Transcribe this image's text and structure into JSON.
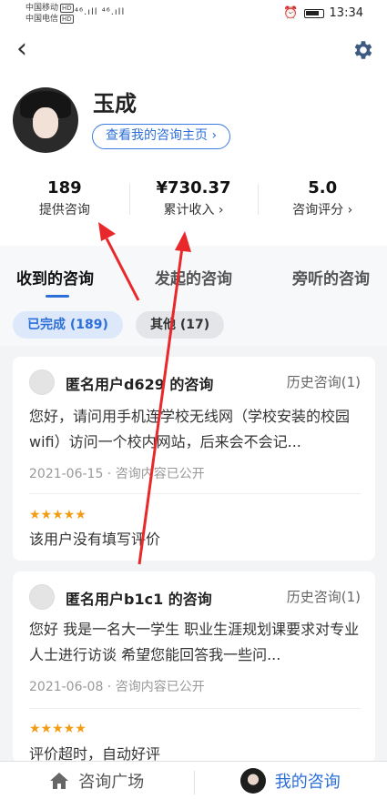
{
  "status_bar": {
    "carrier1": "中国移动",
    "carrier2": "中国电信",
    "hd": "HD",
    "signal": "⁴⁶.ıll ⁴⁶.ıll",
    "time": "13:34"
  },
  "header": {
    "back_icon": "‹",
    "user_name": "玉成",
    "homepage_link": "查看我的咨询主页 ›"
  },
  "stats": [
    {
      "value": "189",
      "label": "提供咨询"
    },
    {
      "value": "¥730.37",
      "label": "累计收入 ›"
    },
    {
      "value": "5.0",
      "label": "咨询评分 ›"
    }
  ],
  "tabs": [
    {
      "label": "收到的咨询",
      "active": true
    },
    {
      "label": "发起的咨询",
      "active": false
    },
    {
      "label": "旁听的咨询",
      "active": false
    }
  ],
  "filters": {
    "completed": "已完成 (189)",
    "other": "其他 (17)"
  },
  "consultations": [
    {
      "title": "匿名用户d629 的咨询",
      "history": "历史咨询(1)",
      "text": "您好，请问用手机连学校无线网（学校安装的校园wifi）访问一个校内网站，后来会不会记...",
      "meta": "2021-06-15 · 咨询内容已公开",
      "rating": 5,
      "stars": "★★★★★",
      "review": "该用户没有填写评价"
    },
    {
      "title": "匿名用户b1c1 的咨询",
      "history": "历史咨询(1)",
      "text": "您好 我是一名大一学生 职业生涯规划课要求对专业人士进行访谈 希望您能回答我一些问...",
      "meta": "2021-06-08 · 咨询内容已公开",
      "rating": 5,
      "stars": "★★★★★",
      "review": "评价超时，自动好评"
    }
  ],
  "bottom_nav": {
    "plaza": "咨询广场",
    "mine": "我的咨询"
  },
  "colors": {
    "accent": "#2c6fd8",
    "star": "#f39c12",
    "arrow": "#e8282b"
  }
}
